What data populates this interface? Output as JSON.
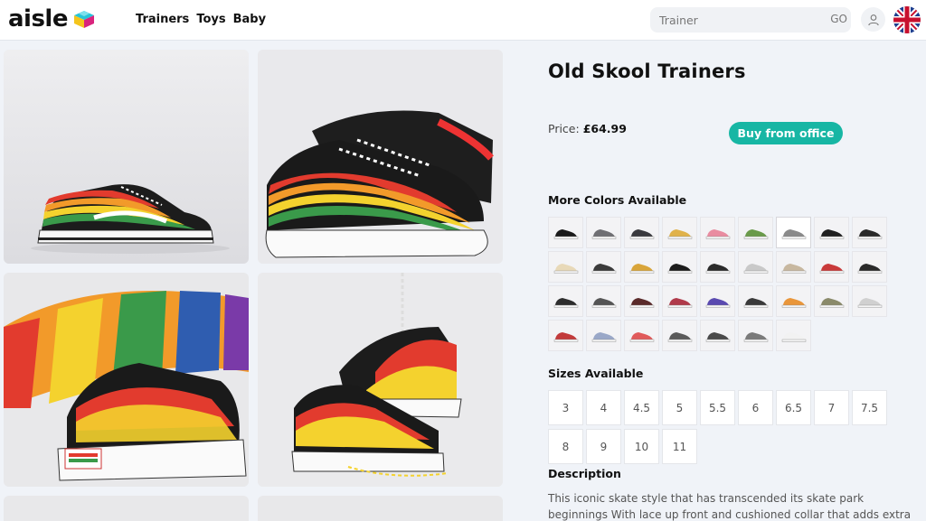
{
  "header": {
    "logo_text": "aisle",
    "nav": [
      "Trainers",
      "Toys",
      "Baby"
    ],
    "search": {
      "placeholder": "Trainer",
      "go_label": "GO"
    },
    "colors": {
      "logo_cyan": "#27c4d8",
      "logo_yellow": "#f4c51c",
      "logo_magenta": "#d9247d"
    }
  },
  "product": {
    "title": "Old Skool Trainers",
    "price_label": "Price:",
    "price_value": "£64.99",
    "buy_label": "Buy from office",
    "more_colors_heading": "More Colors Available",
    "sizes_heading": "Sizes Available",
    "sizes": [
      "3",
      "4",
      "4.5",
      "5",
      "5.5",
      "6",
      "6.5",
      "7",
      "7.5",
      "8",
      "9",
      "10",
      "11"
    ],
    "description_heading": "Description",
    "description": "This iconic skate style that has transcended its skate park beginnings With lace up front and cushioned collar that adds extra comfort and"
  },
  "swatch_colors": [
    "#1a1a1a",
    "#6f6f73",
    "#3a3a3e",
    "#e0b24a",
    "#e98ca0",
    "#6a9a4a",
    "#8a8a8a",
    "#202020",
    "#2a2a2a",
    "#e8d9b8",
    "#3b3b3b",
    "#d9a53a",
    "#1c1c1c",
    "#2b2b2b",
    "#c9c9c9",
    "#c8b8a0",
    "#c93a3a",
    "#2a2a2a",
    "#2d2d2d",
    "#555555",
    "#5a2a2a",
    "#b03a4a",
    "#5a4ab0",
    "#3a3a3a",
    "#e9963a",
    "#8a8a6a",
    "#d0d0d0",
    "#c23a3a",
    "#9aa8c8",
    "#e05a5a",
    "#5a5a5a",
    "#4a4a4a",
    "#7a7a7a",
    "#f2f2f2"
  ],
  "brand": {
    "accent": "#17b6a4"
  }
}
